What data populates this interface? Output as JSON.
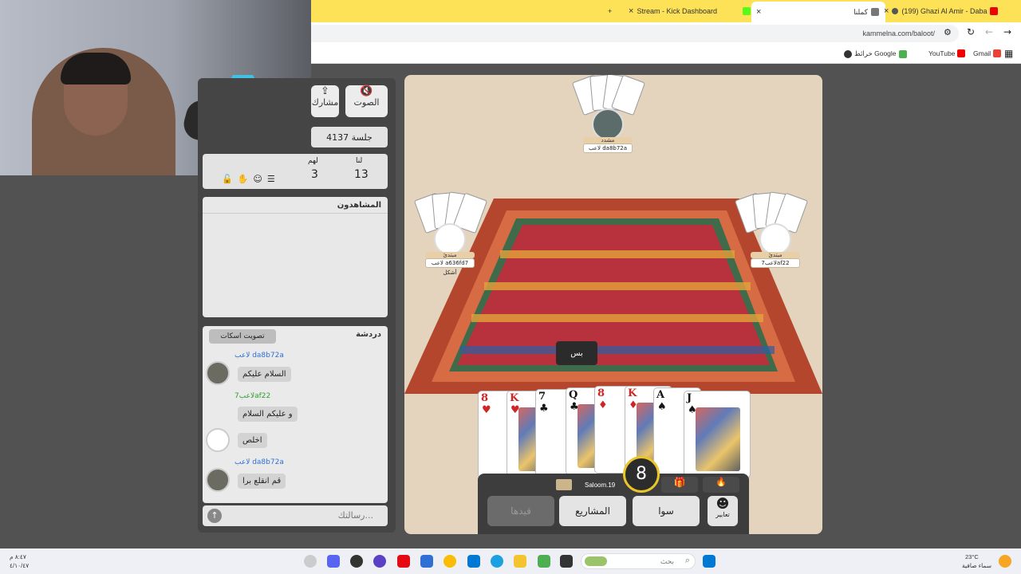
{
  "browser": {
    "tabs": [
      {
        "label": "(199) Ghazi Al Amir - Daba"
      },
      {
        "label": "كملنا"
      },
      {
        "label": "Stream - Kick Dashboard"
      }
    ],
    "url": "kammelna.com/baloot/",
    "bookmarks": [
      {
        "label": "Gmail"
      },
      {
        "label": "YouTube"
      },
      {
        "label": "خرائط Google"
      }
    ]
  },
  "sidebar": {
    "sound_label": "الصوت",
    "share_label": "مشارك",
    "session_label": "جلسة 4137",
    "score": {
      "us_label": "لنا",
      "them_label": "لهم",
      "us_value": "13",
      "them_value": "3"
    },
    "watchers_title": "المشاهدون",
    "chat_title": "دردشة",
    "mute_vote_label": "تصويت اسكات",
    "chat_messages": [
      {
        "name": "لاعب da8b72a",
        "text": "السلام عليكم"
      },
      {
        "name": "لاعب7af22",
        "text": "و عليكم السلام"
      },
      {
        "name": "",
        "text": "اخلص"
      },
      {
        "name": "لاعب da8b72a",
        "text": "قم انقلع برا"
      }
    ],
    "chat_placeholder": "رسالتك..."
  },
  "game": {
    "top_player": {
      "name": "مشدد",
      "id": "لاعب da8b72a"
    },
    "left_player": {
      "name": "مبتدئ",
      "id": "لاعب a636fd7",
      "note": "أشكل"
    },
    "right_player": {
      "name": "مبتدئ",
      "id": "لاعب7af22"
    },
    "bid_label": "بس",
    "hand": [
      {
        "rank": "8",
        "suit": "♥",
        "color": "red"
      },
      {
        "rank": "K",
        "suit": "♥",
        "color": "red"
      },
      {
        "rank": "7",
        "suit": "♣",
        "color": "black"
      },
      {
        "rank": "Q",
        "suit": "♣",
        "color": "black"
      },
      {
        "rank": "8",
        "suit": "♦",
        "color": "red"
      },
      {
        "rank": "K",
        "suit": "♦",
        "color": "red"
      },
      {
        "rank": "A",
        "suit": "♠",
        "color": "black"
      },
      {
        "rank": "J",
        "suit": "♠",
        "color": "black"
      }
    ],
    "me_name": "Saloom.19",
    "timer": "8",
    "buttons": {
      "emotes": "تعابير",
      "sawa": "سوا",
      "projects": "المشاريع",
      "qaydha": "قيدها"
    }
  },
  "taskbar": {
    "search_placeholder": "بحث",
    "weather": "23°C",
    "weather_desc": "سماء صافية",
    "time": "٨:٤٧ م",
    "date": "٤/١٠/٤٧"
  },
  "colors": {
    "tab_bar": "#fde257",
    "board_bg": "#e4d4bd",
    "panel_dark": "#454545"
  }
}
